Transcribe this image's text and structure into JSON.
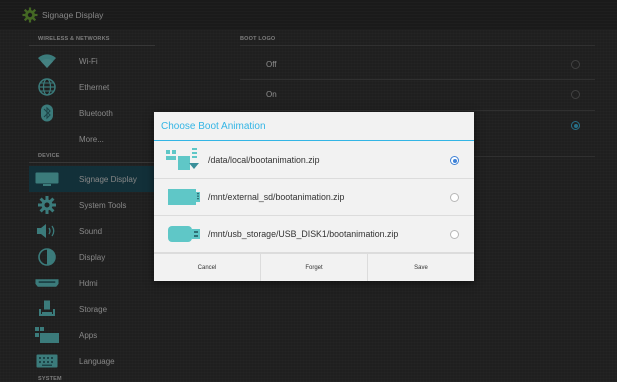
{
  "titlebar": {
    "title": "Signage Display",
    "icon": "gear-icon"
  },
  "sections": {
    "wireless": "WIRELESS & NETWORKS",
    "device": "DEVICE",
    "system": "SYSTEM",
    "boot_logo": "BOOT LOGO"
  },
  "sidebar": {
    "items": [
      {
        "label": "Wi-Fi",
        "icon": "wifi-icon"
      },
      {
        "label": "Ethernet",
        "icon": "ethernet-icon"
      },
      {
        "label": "Bluetooth",
        "icon": "bluetooth-icon"
      },
      {
        "label": "More...",
        "icon": ""
      },
      {
        "label": "Signage Display",
        "icon": "signage-display-icon",
        "active": true
      },
      {
        "label": "System Tools",
        "icon": "system-tools-icon"
      },
      {
        "label": "Sound",
        "icon": "speaker-icon"
      },
      {
        "label": "Display",
        "icon": "display-icon"
      },
      {
        "label": "Hdmi",
        "icon": "hdmi-icon"
      },
      {
        "label": "Storage",
        "icon": "storage-icon"
      },
      {
        "label": "Apps",
        "icon": "apps-icon"
      },
      {
        "label": "Language",
        "icon": "keyboard-icon"
      }
    ]
  },
  "boot_logo": {
    "options": [
      {
        "label": "Off",
        "selected": false
      },
      {
        "label": "On",
        "selected": false
      },
      {
        "label": "",
        "selected": true
      }
    ]
  },
  "dialog": {
    "title": "Choose Boot Animation",
    "options": [
      {
        "label": "/data/local/bootanimation.zip",
        "icon": "device-download-icon",
        "selected": true
      },
      {
        "label": "/mnt/external_sd/bootanimation.zip",
        "icon": "sd-card-icon",
        "selected": false
      },
      {
        "label": "/mnt/usb_storage/USB_DISK1/bootanimation.zip",
        "icon": "usb-drive-icon",
        "selected": false
      }
    ],
    "buttons": {
      "cancel": "Cancel",
      "forget": "Forget",
      "save": "Save"
    }
  },
  "colors": {
    "accent": "#33b5e5",
    "active_bg": "#1e4e5c",
    "icon_teal": "#5fc7c7"
  }
}
